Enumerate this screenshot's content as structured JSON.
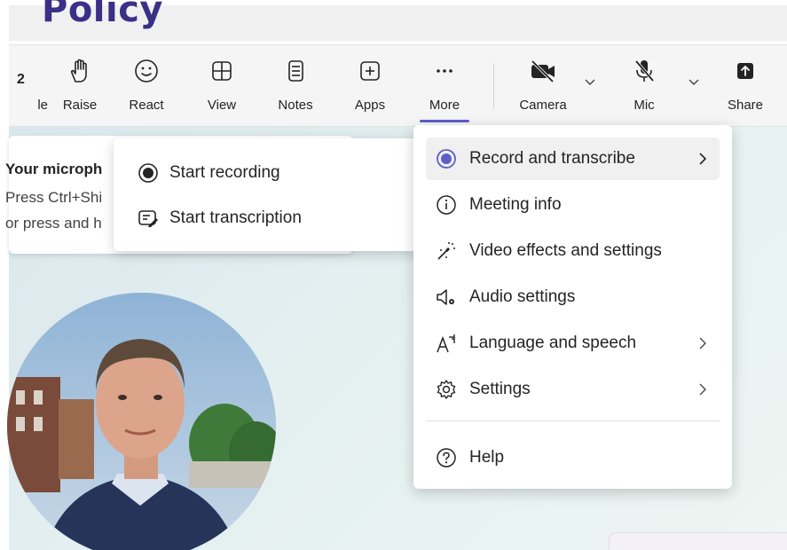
{
  "slide": {
    "title": "Policy"
  },
  "toolbar": {
    "items": [
      {
        "label": "le",
        "icon": "people-count-icon",
        "count": "2"
      },
      {
        "label": "Raise",
        "icon": "raise-hand-icon"
      },
      {
        "label": "React",
        "icon": "smiley-icon"
      },
      {
        "label": "View",
        "icon": "grid-view-icon"
      },
      {
        "label": "Notes",
        "icon": "notes-icon"
      },
      {
        "label": "Apps",
        "icon": "add-apps-icon"
      },
      {
        "label": "More",
        "icon": "more-icon",
        "active": true
      },
      {
        "label": "Camera",
        "icon": "camera-off-icon"
      },
      {
        "label": "Mic",
        "icon": "mic-off-icon"
      },
      {
        "label": "Share",
        "icon": "share-icon"
      }
    ],
    "accent_color": "#5b5fc7"
  },
  "notice": {
    "title": "Your microph",
    "line1": "Press Ctrl+Shi",
    "line2": "or press and h"
  },
  "submenu": {
    "items": [
      {
        "label": "Start recording",
        "icon": "record-icon"
      },
      {
        "label": "Start transcription",
        "icon": "transcription-icon"
      }
    ]
  },
  "menu": {
    "items": [
      {
        "label": "Record and transcribe",
        "icon": "record-accent-icon",
        "submenu": true,
        "highlighted": true
      },
      {
        "label": "Meeting info",
        "icon": "info-icon",
        "submenu": false
      },
      {
        "label": "Video effects and settings",
        "icon": "magic-wand-icon",
        "submenu": false
      },
      {
        "label": "Audio settings",
        "icon": "speaker-settings-icon",
        "submenu": false
      },
      {
        "label": "Language and speech",
        "icon": "language-icon",
        "submenu": true
      },
      {
        "label": "Settings",
        "icon": "gear-icon",
        "submenu": true
      },
      {
        "label": "Help",
        "icon": "help-icon",
        "submenu": false
      }
    ]
  }
}
